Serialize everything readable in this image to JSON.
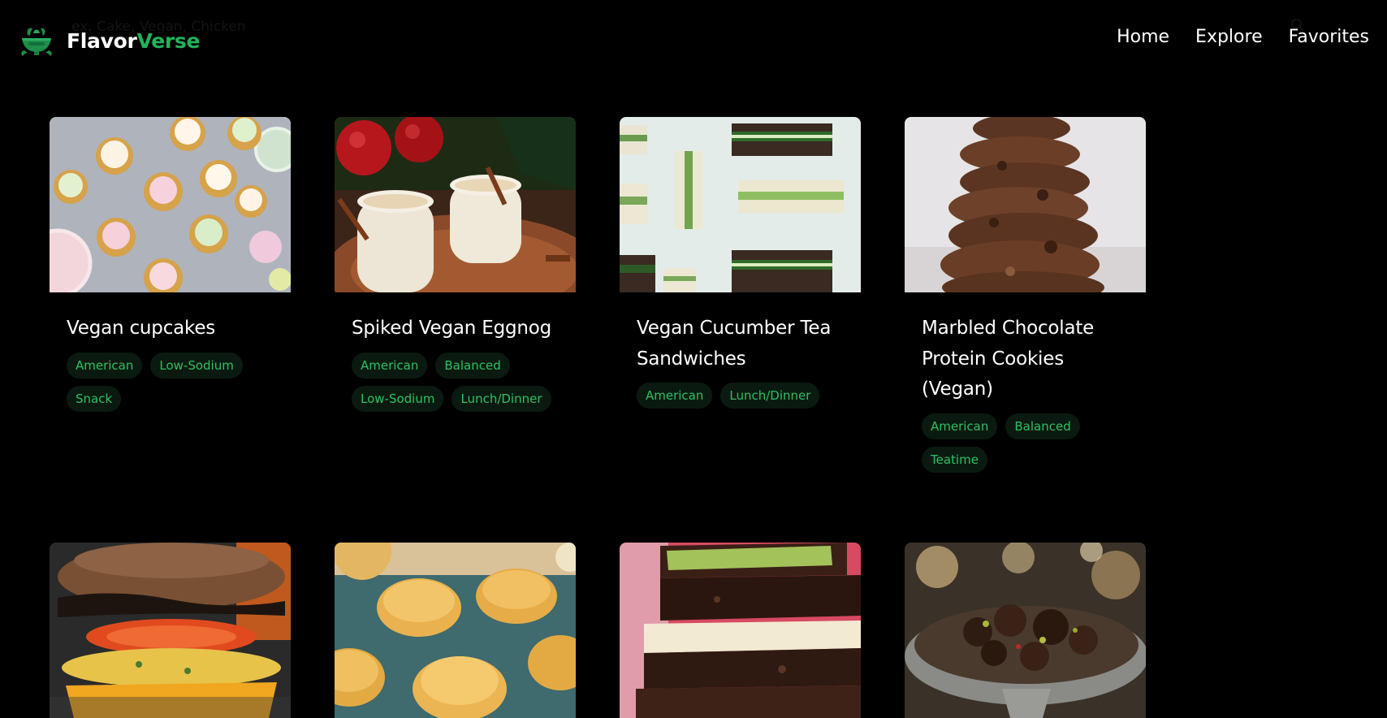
{
  "search": {
    "placeholder": "ex. Cake, Vegan, Chicken"
  },
  "brand": {
    "name_part1": "Flavor",
    "name_part2": "Verse",
    "accent_color": "#22b25a"
  },
  "nav": {
    "items": [
      {
        "label": "Home"
      },
      {
        "label": "Explore"
      },
      {
        "label": "Favorites"
      }
    ]
  },
  "recipes": [
    {
      "title": "Vegan cupcakes",
      "tags": [
        "American",
        "Low-Sodium",
        "Snack"
      ]
    },
    {
      "title": "Spiked Vegan Eggnog",
      "tags": [
        "American",
        "Balanced",
        "Low-Sodium",
        "Lunch/Dinner"
      ]
    },
    {
      "title": "Vegan Cucumber Tea Sandwiches",
      "tags": [
        "American",
        "Lunch/Dinner"
      ]
    },
    {
      "title": "Marbled Chocolate Protein Cookies (Vegan)",
      "tags": [
        "American",
        "Balanced",
        "Teatime"
      ]
    },
    {
      "title": "",
      "tags": []
    },
    {
      "title": "",
      "tags": []
    },
    {
      "title": "",
      "tags": []
    },
    {
      "title": "",
      "tags": []
    }
  ],
  "colors": {
    "background": "#000000",
    "tag_text": "#2fbf63",
    "tag_bg": "#0b1a10"
  }
}
